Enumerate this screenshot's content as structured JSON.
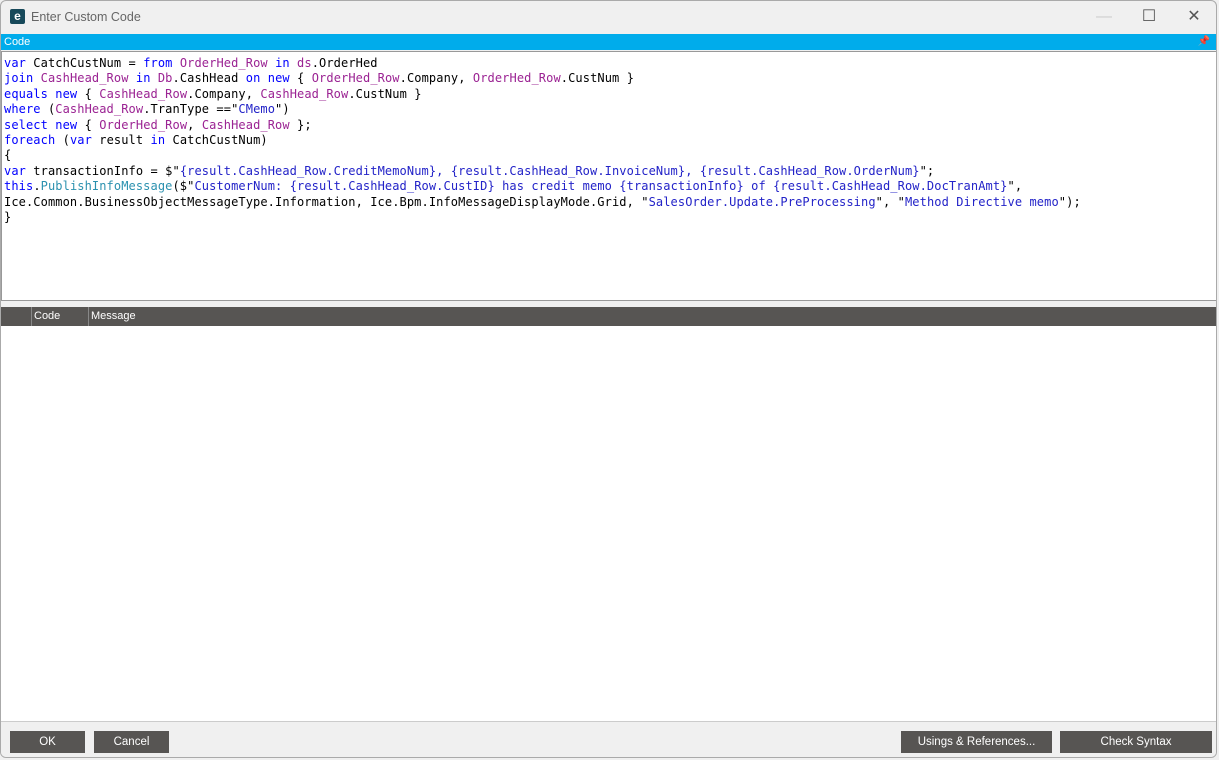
{
  "window": {
    "title": "Enter Custom Code",
    "logo": "e",
    "minimize": "—",
    "maximize": "☐",
    "close": "✕"
  },
  "code_panel": {
    "header": "Code",
    "pin": "pin-icon"
  },
  "code_lines": [
    [
      [
        "var",
        "k"
      ],
      [
        " CatchCustNum = ",
        "p"
      ],
      [
        "from",
        "k"
      ],
      [
        " ",
        "p"
      ],
      [
        "OrderHed_Row",
        "v"
      ],
      [
        " ",
        "p"
      ],
      [
        "in",
        "k"
      ],
      [
        " ",
        "p"
      ],
      [
        "ds",
        "v"
      ],
      [
        ".OrderHed",
        "p"
      ]
    ],
    [
      [
        "join",
        "k"
      ],
      [
        " ",
        "p"
      ],
      [
        "CashHead_Row",
        "v"
      ],
      [
        " ",
        "p"
      ],
      [
        "in",
        "k"
      ],
      [
        " ",
        "p"
      ],
      [
        "Db",
        "v"
      ],
      [
        ".CashHead ",
        "p"
      ],
      [
        "on",
        "k"
      ],
      [
        " ",
        "p"
      ],
      [
        "new",
        "k"
      ],
      [
        " { ",
        "p"
      ],
      [
        "OrderHed_Row",
        "v"
      ],
      [
        ".Company, ",
        "p"
      ],
      [
        "OrderHed_Row",
        "v"
      ],
      [
        ".CustNum }",
        "p"
      ]
    ],
    [
      [
        "equals",
        "k"
      ],
      [
        " ",
        "p"
      ],
      [
        "new",
        "k"
      ],
      [
        " { ",
        "p"
      ],
      [
        "CashHead_Row",
        "v"
      ],
      [
        ".Company, ",
        "p"
      ],
      [
        "CashHead_Row",
        "v"
      ],
      [
        ".CustNum }",
        "p"
      ]
    ],
    [
      [
        "where",
        "k"
      ],
      [
        " (",
        "p"
      ],
      [
        "CashHead_Row",
        "v"
      ],
      [
        ".TranType ==\"",
        "p"
      ],
      [
        "CMemo",
        "s"
      ],
      [
        "\")",
        "p"
      ]
    ],
    [
      [
        "select",
        "k"
      ],
      [
        " ",
        "p"
      ],
      [
        "new",
        "k"
      ],
      [
        " { ",
        "p"
      ],
      [
        "OrderHed_Row",
        "v"
      ],
      [
        ", ",
        "p"
      ],
      [
        "CashHead_Row",
        "v"
      ],
      [
        " };",
        "p"
      ]
    ],
    [
      [
        "foreach",
        "k"
      ],
      [
        " (",
        "p"
      ],
      [
        "var",
        "k"
      ],
      [
        " result ",
        "p"
      ],
      [
        "in",
        "k"
      ],
      [
        " CatchCustNum)",
        "p"
      ]
    ],
    [
      [
        "{",
        "p"
      ]
    ],
    [
      [
        "var",
        "k"
      ],
      [
        " transactionInfo = $\"",
        "p"
      ],
      [
        "{result.CashHead_Row.CreditMemoNum}, {result.CashHead_Row.InvoiceNum}, {result.CashHead_Row.OrderNum}",
        "s"
      ],
      [
        "\";",
        "p"
      ]
    ],
    [
      [
        "this",
        "k"
      ],
      [
        ".",
        "p"
      ],
      [
        "PublishInfoMessage",
        "m"
      ],
      [
        "($\"",
        "p"
      ],
      [
        "CustomerNum: {result.CashHead_Row.CustID} has credit memo {transactionInfo} of {result.CashHead_Row.DocTranAmt}",
        "s"
      ],
      [
        "\",",
        "p"
      ]
    ],
    [
      [
        "Ice.Common.BusinessObjectMessageType.Information, Ice.Bpm.InfoMessageDisplayMode.Grid, \"",
        "p"
      ],
      [
        "SalesOrder.Update.PreProcessing",
        "s"
      ],
      [
        "\", \"",
        "p"
      ],
      [
        "Method Directive memo",
        "s"
      ],
      [
        "\");",
        "p"
      ]
    ],
    [
      [
        "}",
        "p"
      ]
    ]
  ],
  "grid": {
    "columns": [
      "",
      "Code",
      "Message"
    ]
  },
  "buttons": {
    "ok": "OK",
    "cancel": "Cancel",
    "usings": "Usings & References...",
    "check": "Check Syntax"
  }
}
